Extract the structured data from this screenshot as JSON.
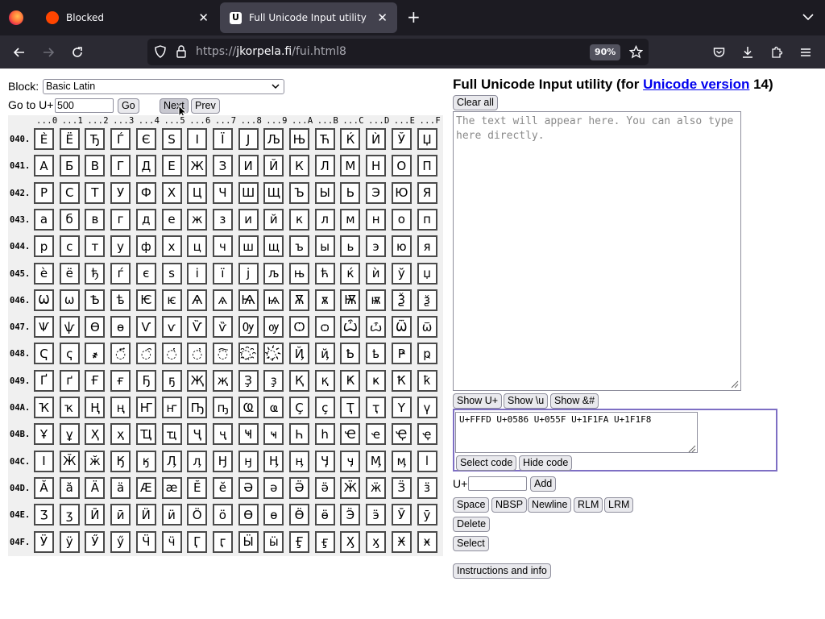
{
  "browser": {
    "tabs": [
      {
        "title": "Blocked",
        "favicon_color": "#ff4500"
      },
      {
        "title": "Full Unicode Input utility",
        "favicon_color": "#ffffff"
      }
    ],
    "url_prefix": "https://",
    "url_host": "jkorpela.fi",
    "url_path": "/fui.html8",
    "zoom": "90%"
  },
  "controls": {
    "block_label": "Block:",
    "block_value": "Basic Latin",
    "goto_label": "Go to U+",
    "goto_value": "500",
    "go_button": "Go",
    "next_button": "Next",
    "prev_button": "Prev"
  },
  "table": {
    "col_headers": [
      "...0",
      "...1",
      "...2",
      "...3",
      "...4",
      "...5",
      "...6",
      "...7",
      "...8",
      "...9",
      "...A",
      "...B",
      "...C",
      "...D",
      "...E",
      "...F"
    ],
    "rows": [
      {
        "label": "040.",
        "chars": [
          "Ѐ",
          "Ё",
          "Ђ",
          "Ѓ",
          "Є",
          "Ѕ",
          "І",
          "Ї",
          "Ј",
          "Љ",
          "Њ",
          "Ћ",
          "Ќ",
          "Ѝ",
          "Ў",
          "Џ"
        ]
      },
      {
        "label": "041.",
        "chars": [
          "А",
          "Б",
          "В",
          "Г",
          "Д",
          "Е",
          "Ж",
          "З",
          "И",
          "Й",
          "К",
          "Л",
          "М",
          "Н",
          "О",
          "П"
        ]
      },
      {
        "label": "042.",
        "chars": [
          "Р",
          "С",
          "Т",
          "У",
          "Ф",
          "Х",
          "Ц",
          "Ч",
          "Ш",
          "Щ",
          "Ъ",
          "Ы",
          "Ь",
          "Э",
          "Ю",
          "Я"
        ]
      },
      {
        "label": "043.",
        "chars": [
          "а",
          "б",
          "в",
          "г",
          "д",
          "е",
          "ж",
          "з",
          "и",
          "й",
          "к",
          "л",
          "м",
          "н",
          "о",
          "п"
        ]
      },
      {
        "label": "044.",
        "chars": [
          "р",
          "с",
          "т",
          "у",
          "ф",
          "х",
          "ц",
          "ч",
          "ш",
          "щ",
          "ъ",
          "ы",
          "ь",
          "э",
          "ю",
          "я"
        ]
      },
      {
        "label": "045.",
        "chars": [
          "ѐ",
          "ё",
          "ђ",
          "ѓ",
          "є",
          "ѕ",
          "і",
          "ї",
          "ј",
          "љ",
          "њ",
          "ћ",
          "ќ",
          "ѝ",
          "ў",
          "џ"
        ]
      },
      {
        "label": "046.",
        "chars": [
          "Ѡ",
          "ѡ",
          "Ѣ",
          "ѣ",
          "Ѥ",
          "ѥ",
          "Ѧ",
          "ѧ",
          "Ѩ",
          "ѩ",
          "Ѫ",
          "ѫ",
          "Ѭ",
          "ѭ",
          "Ѯ",
          "ѯ"
        ]
      },
      {
        "label": "047.",
        "chars": [
          "Ѱ",
          "ѱ",
          "Ѳ",
          "ѳ",
          "Ѵ",
          "ѵ",
          "Ѷ",
          "ѷ",
          "Ѹ",
          "ѹ",
          "Ѻ",
          "ѻ",
          "Ѽ",
          "ѽ",
          "Ѿ",
          "ѿ"
        ]
      },
      {
        "label": "048.",
        "chars": [
          "Ҁ",
          "ҁ",
          "҂",
          "◌҃",
          "◌҄",
          "◌҅",
          "◌҆",
          "◌҇",
          "◌҈",
          "◌҉",
          "Ҋ",
          "ҋ",
          "Ҍ",
          "ҍ",
          "Ҏ",
          "ҏ"
        ]
      },
      {
        "label": "049.",
        "chars": [
          "Ґ",
          "ґ",
          "Ғ",
          "ғ",
          "Ҕ",
          "ҕ",
          "Җ",
          "җ",
          "Ҙ",
          "ҙ",
          "Қ",
          "қ",
          "Ҝ",
          "ҝ",
          "Ҟ",
          "ҟ"
        ]
      },
      {
        "label": "04A.",
        "chars": [
          "Ҡ",
          "ҡ",
          "Ң",
          "ң",
          "Ҥ",
          "ҥ",
          "Ҧ",
          "ҧ",
          "Ҩ",
          "ҩ",
          "Ҫ",
          "ҫ",
          "Ҭ",
          "ҭ",
          "Ү",
          "ү"
        ]
      },
      {
        "label": "04B.",
        "chars": [
          "Ұ",
          "ұ",
          "Ҳ",
          "ҳ",
          "Ҵ",
          "ҵ",
          "Ҷ",
          "ҷ",
          "Ҹ",
          "ҹ",
          "Һ",
          "һ",
          "Ҽ",
          "ҽ",
          "Ҿ",
          "ҿ"
        ]
      },
      {
        "label": "04C.",
        "chars": [
          "Ӏ",
          "Ӂ",
          "ӂ",
          "Ӄ",
          "ӄ",
          "Ӆ",
          "ӆ",
          "Ӈ",
          "ӈ",
          "Ӊ",
          "ӊ",
          "Ӌ",
          "ӌ",
          "Ӎ",
          "ӎ",
          "ӏ"
        ]
      },
      {
        "label": "04D.",
        "chars": [
          "Ӑ",
          "ӑ",
          "Ӓ",
          "ӓ",
          "Ӕ",
          "ӕ",
          "Ӗ",
          "ӗ",
          "Ә",
          "ә",
          "Ӛ",
          "ӛ",
          "Ӝ",
          "ӝ",
          "Ӟ",
          "ӟ"
        ]
      },
      {
        "label": "04E.",
        "chars": [
          "Ӡ",
          "ӡ",
          "Ӣ",
          "ӣ",
          "Ӥ",
          "ӥ",
          "Ӧ",
          "ӧ",
          "Ө",
          "ө",
          "Ӫ",
          "ӫ",
          "Ӭ",
          "ӭ",
          "Ӯ",
          "ӯ"
        ]
      },
      {
        "label": "04F.",
        "chars": [
          "Ӱ",
          "ӱ",
          "Ӳ",
          "ӳ",
          "Ӵ",
          "ӵ",
          "Ӷ",
          "ӷ",
          "Ӹ",
          "ӹ",
          "Ӻ",
          "ӻ",
          "Ӽ",
          "ӽ",
          "Ӿ",
          "ӿ"
        ]
      }
    ]
  },
  "right": {
    "title_prefix": "Full Unicode Input utility (for ",
    "title_link": "Unicode version",
    "title_suffix": " 14)",
    "clear_all": "Clear all",
    "output_placeholder": "The text will appear here. You can also type here directly.",
    "show_uplus": "Show U+",
    "show_u": "Show \\u",
    "show_amp": "Show &#",
    "code_value": "U+FFFD U+0586 U+055F U+1F1FA U+1F1F8",
    "select_code": "Select code",
    "hide_code": "Hide code",
    "uplus_label": "U+",
    "add_button": "Add",
    "space_button": "Space",
    "nbsp_button": "NBSP",
    "newline_button": "Newline",
    "rlm_button": "RLM",
    "lrm_button": "LRM",
    "delete_button": "Delete",
    "select_button": "Select",
    "instructions_button": "Instructions and info"
  },
  "colors": {
    "tabbar_bg": "#1c1b22",
    "navbar_bg": "#2b2a33",
    "active_tab": "#42414d",
    "link": "#0000ee",
    "focus_border": "#7e6fc4"
  }
}
